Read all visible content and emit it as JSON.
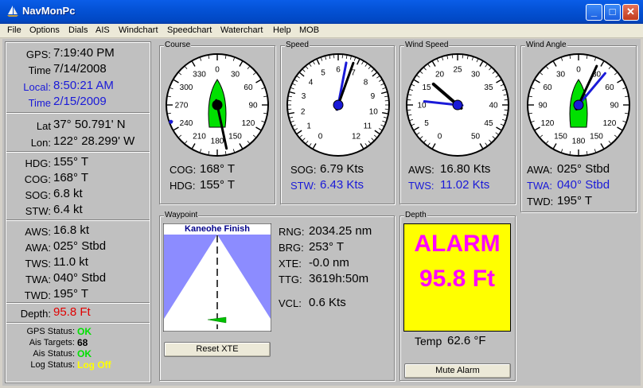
{
  "window": {
    "title": "NavMonPc",
    "minimize_label": "_",
    "maximize_label": "□",
    "close_label": "✕"
  },
  "menu": [
    "File",
    "Options",
    "Dials",
    "AIS",
    "Windchart",
    "Speedchart",
    "Waterchart",
    "Help",
    "MOB"
  ],
  "info": {
    "gps": {
      "label": "GPS:",
      "value": "7:19:40 PM"
    },
    "time": {
      "label": "Time",
      "value": "7/14/2008"
    },
    "local": {
      "label": "Local:",
      "value": "8:50:21 AM"
    },
    "local_time": {
      "label": "Time",
      "value": "2/15/2009"
    },
    "lat": {
      "label": "Lat",
      "value": "37° 50.791' N"
    },
    "lon": {
      "label": "Lon:",
      "value": "122° 28.299' W"
    },
    "hdg": {
      "label": "HDG:",
      "value": "155° T"
    },
    "cog": {
      "label": "COG:",
      "value": "168° T"
    },
    "sog": {
      "label": "SOG:",
      "value": "6.8 kt"
    },
    "stw": {
      "label": "STW:",
      "value": "6.4 kt"
    },
    "aws": {
      "label": "AWS:",
      "value": "16.8 kt"
    },
    "awa": {
      "label": "AWA:",
      "value": "025° Stbd"
    },
    "tws": {
      "label": "TWS:",
      "value": "11.0 kt"
    },
    "twa": {
      "label": "TWA:",
      "value": "040° Stbd"
    },
    "twd": {
      "label": "TWD:",
      "value": "195° T"
    },
    "depth": {
      "label": "Depth:",
      "value": "95.8 Ft"
    }
  },
  "status": {
    "gps": {
      "label": "GPS Status:",
      "value": "OK",
      "color": "#00e000"
    },
    "ais_targets": {
      "label": "Ais Targets:",
      "value": "68",
      "color": "#000000"
    },
    "ais": {
      "label": "Ais Status:",
      "value": "OK",
      "color": "#00e000"
    },
    "log": {
      "label": "Log Status:",
      "value": "Log Off",
      "color": "#ffff00"
    }
  },
  "course": {
    "title": "Course",
    "ticks": [
      "30",
      "60",
      "90",
      "120",
      "150",
      "180",
      "210",
      "240",
      "270",
      "300",
      "330",
      "0"
    ],
    "heading_deg": 155,
    "cog_deg": 168,
    "cog": {
      "label": "COG:",
      "value": "168° T"
    },
    "hdg": {
      "label": "HDG:",
      "value": "155° T"
    }
  },
  "speed": {
    "title": "Speed",
    "ticks": [
      "0",
      "1",
      "2",
      "3",
      "4",
      "5",
      "6",
      "7",
      "8",
      "9",
      "10",
      "11",
      "12"
    ],
    "sog_kts": 6.79,
    "stw_kts": 6.43,
    "sog": {
      "label": "SOG:",
      "value": "6.79 Kts"
    },
    "stw": {
      "label": "STW:",
      "value": "6.43 Kts"
    }
  },
  "wind_speed": {
    "title": "Wind Speed",
    "ticks": [
      "0",
      "5",
      "10",
      "15",
      "20",
      "25",
      "30",
      "35",
      "40",
      "45",
      "50"
    ],
    "aws_kts": 16.8,
    "tws_kts": 11.02,
    "aws": {
      "label": "AWS:",
      "value": "16.80 Kts"
    },
    "tws": {
      "label": "TWS:",
      "value": "11.02 Kts"
    }
  },
  "wind_angle": {
    "title": "Wind Angle",
    "ticks": [
      "30",
      "60",
      "90",
      "120",
      "150",
      "180",
      "150",
      "120",
      "90",
      "60",
      "30",
      "0"
    ],
    "awa_deg": 25,
    "twa_deg": 40,
    "awa": {
      "label": "AWA:",
      "value": "025° Stbd"
    },
    "twa": {
      "label": "TWA:",
      "value": "040° Stbd"
    },
    "twd": {
      "label": "TWD:",
      "value": "195° T"
    }
  },
  "waypoint": {
    "title": "Waypoint",
    "name": "Kaneohe Finish",
    "rng": {
      "label": "RNG:",
      "value": "2034.25 nm"
    },
    "brg": {
      "label": "BRG:",
      "value": "253° T"
    },
    "xte": {
      "label": "XTE:",
      "value": "-0.0 nm"
    },
    "ttg": {
      "label": "TTG:",
      "value": "3619h:50m"
    },
    "vcl": {
      "label": "VCL:",
      "value": "0.6 Kts"
    },
    "reset_label": "Reset XTE"
  },
  "depth_panel": {
    "title": "Depth",
    "alarm_text": "ALARM",
    "depth_value": "95.8 Ft",
    "temp_label": "Temp",
    "temp_value": "62.6 °F",
    "mute_label": "Mute Alarm"
  },
  "colors": {
    "accent_blue": "#1a1ad8",
    "boat_green": "#00e000",
    "needle_black": "#000000",
    "needle_blue": "#1a1ad8",
    "alarm_bg": "#ffff00",
    "alarm_text": "#ff00ff",
    "waypoint_sky": "#8c8cff"
  }
}
